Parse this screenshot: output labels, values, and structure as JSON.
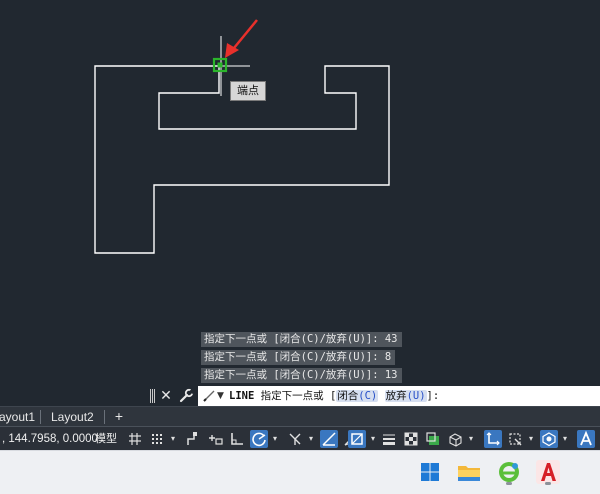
{
  "drawing": {
    "snap_tooltip": "端点"
  },
  "command_history": [
    "指定下一点或 [闭合(C)/放弃(U)]: 43",
    "指定下一点或 [闭合(C)/放弃(U)]: 8",
    "指定下一点或 [闭合(C)/放弃(U)]: 13"
  ],
  "command_line": {
    "command": "LINE",
    "prompt": "指定下一点或",
    "open_bracket": "[",
    "option_close": "闭合",
    "option_close_key": "(C)",
    "option_undo": "放弃",
    "option_undo_key": "(U)",
    "close_bracket": "]:"
  },
  "layout_tabs": {
    "tabs": [
      "ayout1",
      "Layout2"
    ],
    "add_label": "+"
  },
  "status_bar": {
    "coordinates": ", 144.7958, 0.0000",
    "model_label": "模型",
    "dropdown_glyph": "▾"
  },
  "taskbar": {
    "apps": [
      "windows-start",
      "file-explorer",
      "browser",
      "autocad"
    ]
  },
  "colors": {
    "canvas": "#212830",
    "geometry": "#ffffff",
    "snap_marker": "#2bb52b",
    "arrow": "#e8302b",
    "toggle_active": "#3a77c0",
    "command_option": "#2850c8"
  }
}
